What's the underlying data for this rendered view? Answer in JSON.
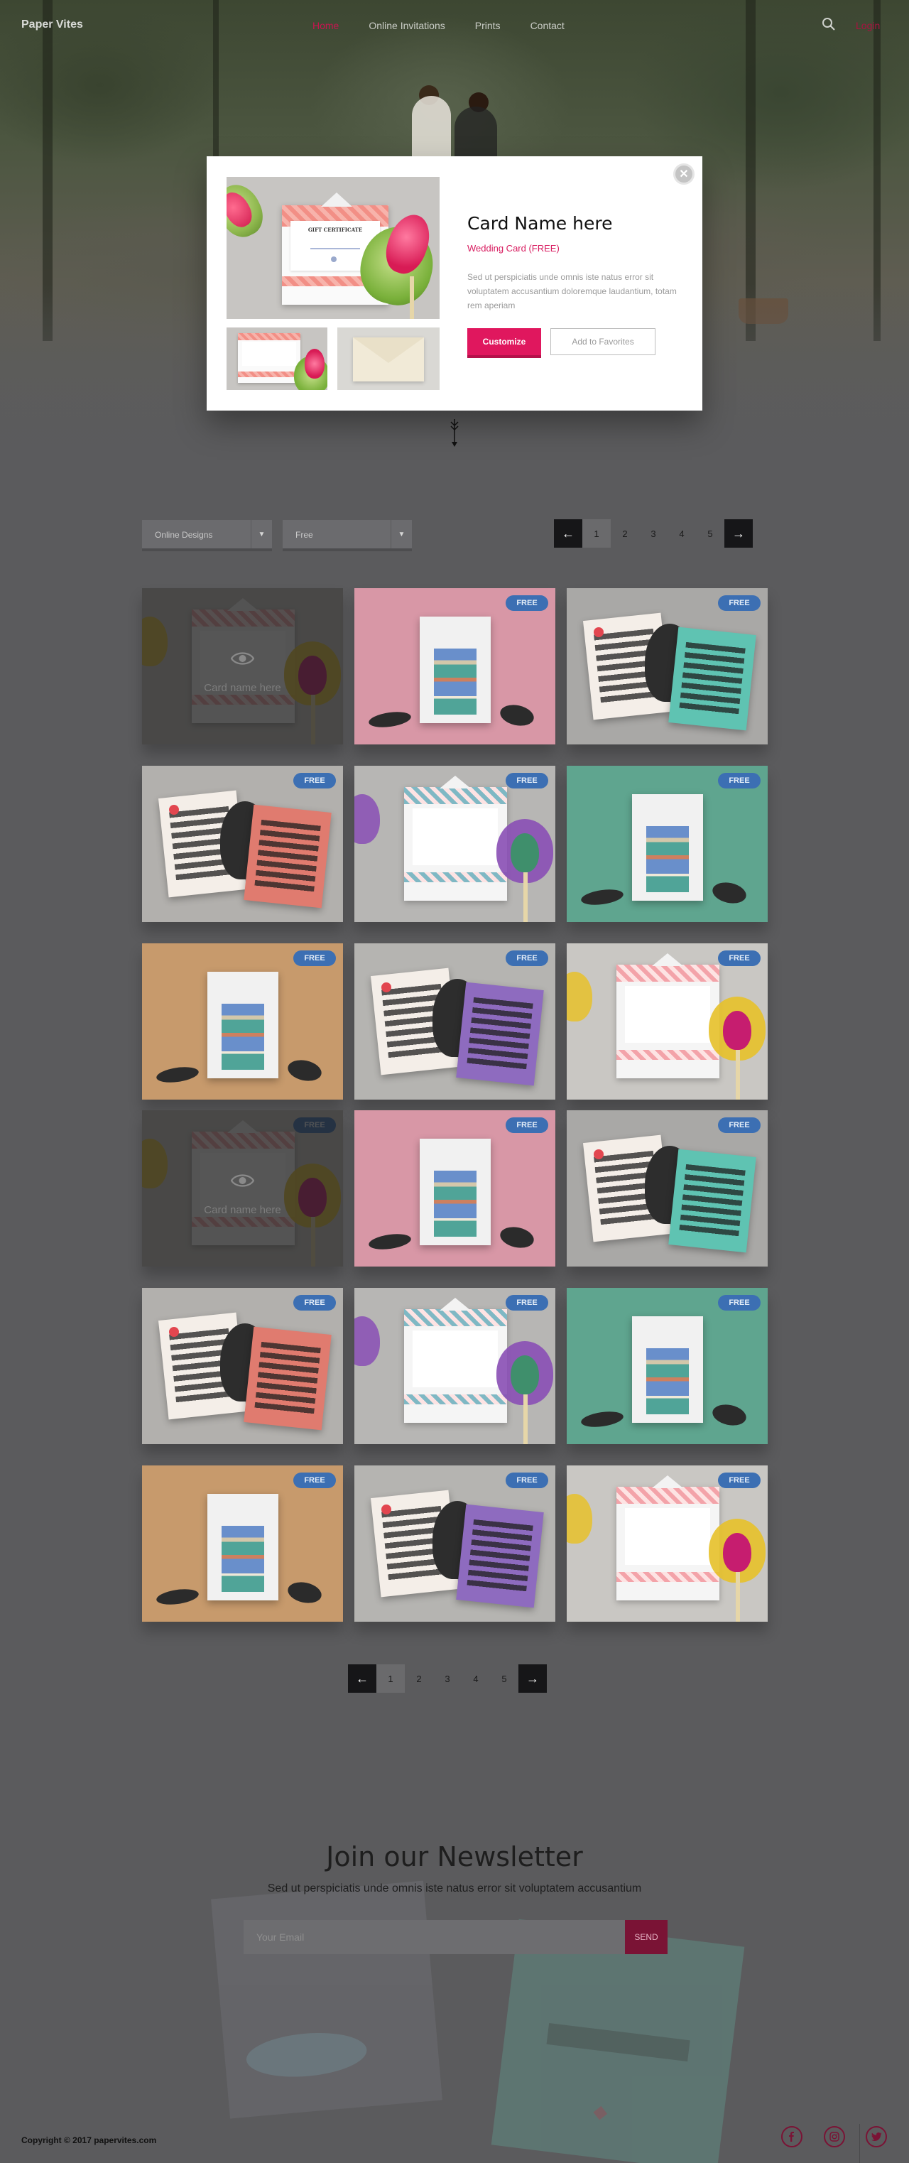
{
  "nav": {
    "logo": "Paper Vites",
    "items": [
      {
        "label": "Home",
        "active": true
      },
      {
        "label": "Online Invitations",
        "active": false
      },
      {
        "label": "Prints",
        "active": false
      },
      {
        "label": "Contact",
        "active": false
      }
    ],
    "login_label": "Login",
    "search_icon": "search-icon"
  },
  "modal": {
    "title": "Card Name here",
    "subtitle": "Wedding Card (FREE)",
    "description": "Sed ut perspiciatis unde omnis iste natus error sit voluptatem accusantium doloremque laudantium, totam rem aperiam",
    "customize_label": "Customize",
    "favorites_label": "Add to Favorites",
    "close_icon": "close-icon",
    "card_heading": "GIFT CERTIFICATE"
  },
  "filters": {
    "design_select": "Online Designs",
    "price_select": "Free"
  },
  "pagination": {
    "pages": [
      "1",
      "2",
      "3",
      "4",
      "5"
    ],
    "active_page": "1"
  },
  "grid": {
    "badge_label": "FREE",
    "overlay_label": "Card name here",
    "overlay_icon": "eye-icon",
    "cards": [
      {
        "art": "certificate-pink",
        "bg": "#c9c7c3",
        "badge": false,
        "overlay": true
      },
      {
        "art": "poster",
        "bg": "#d897a6",
        "badge": true,
        "overlay": false
      },
      {
        "art": "invitation-teal",
        "bg": "#a9a8a6",
        "badge": true,
        "overlay": false
      },
      {
        "art": "invitation-coral",
        "bg": "#b2b0ad",
        "badge": true,
        "overlay": false
      },
      {
        "art": "certificate-teal",
        "bg": "#b7b6b4",
        "badge": true,
        "overlay": false
      },
      {
        "art": "poster",
        "bg": "#5fa58f",
        "badge": true,
        "overlay": false
      },
      {
        "art": "poster",
        "bg": "#c79a6c",
        "badge": true,
        "overlay": false
      },
      {
        "art": "invitation-purple",
        "bg": "#b5b4b1",
        "badge": true,
        "overlay": false
      },
      {
        "art": "certificate-pink",
        "bg": "#c9c7c3",
        "badge": true,
        "overlay": false
      },
      {
        "art": "certificate-pink",
        "bg": "#c9c7c3",
        "badge": true,
        "overlay": true
      },
      {
        "art": "poster",
        "bg": "#d897a6",
        "badge": true,
        "overlay": false
      },
      {
        "art": "invitation-teal",
        "bg": "#a9a8a6",
        "badge": true,
        "overlay": false
      },
      {
        "art": "invitation-coral",
        "bg": "#b2b0ad",
        "badge": true,
        "overlay": false
      },
      {
        "art": "certificate-teal",
        "bg": "#b7b6b4",
        "badge": true,
        "overlay": false
      },
      {
        "art": "poster",
        "bg": "#5fa58f",
        "badge": true,
        "overlay": false
      },
      {
        "art": "poster",
        "bg": "#c79a6c",
        "badge": true,
        "overlay": false
      },
      {
        "art": "invitation-purple",
        "bg": "#b5b4b1",
        "badge": true,
        "overlay": false
      },
      {
        "art": "certificate-pink",
        "bg": "#c9c7c3",
        "badge": true,
        "overlay": false
      }
    ]
  },
  "newsletter": {
    "title": "Join our Newsletter",
    "subtitle": "Sed ut perspiciatis unde omnis iste natus error sit voluptatem accusantium",
    "email_placeholder": "Your Email",
    "send_label": "SEND"
  },
  "footer": {
    "copyright": "Copyright © 2017 papervites.com",
    "social_icons": [
      "facebook-icon",
      "instagram-icon",
      "twitter-icon"
    ]
  },
  "colors": {
    "accent": "#e0175e",
    "badge": "#3c6fb3",
    "dark": "#161618"
  }
}
